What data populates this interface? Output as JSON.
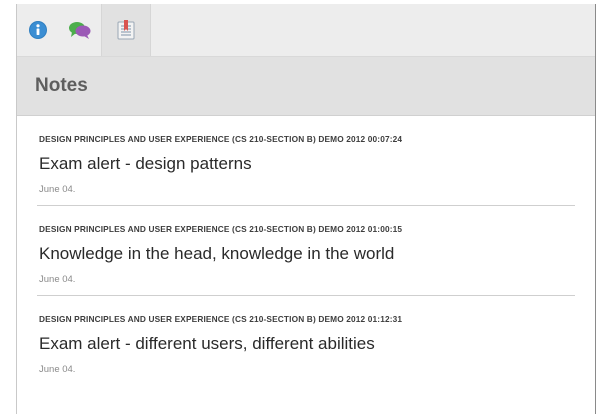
{
  "tabs": [
    {
      "icon": "info-icon",
      "active": false
    },
    {
      "icon": "chat-icon",
      "active": false
    },
    {
      "icon": "notes-bookmark-icon",
      "active": true
    }
  ],
  "panel": {
    "title": "Notes"
  },
  "notes": [
    {
      "meta": "DESIGN PRINCIPLES AND USER EXPERIENCE (CS 210-SECTION B) DEMO 2012 00:07:24",
      "title": "Exam alert - design patterns",
      "date": "June 04."
    },
    {
      "meta": "DESIGN PRINCIPLES AND USER EXPERIENCE (CS 210-SECTION B) DEMO 2012 01:00:15",
      "title": "Knowledge in the head, knowledge in the world",
      "date": "June 04."
    },
    {
      "meta": "DESIGN PRINCIPLES AND USER EXPERIENCE (CS 210-SECTION B) DEMO 2012 01:12:31",
      "title": "Exam alert - different users, different abilities",
      "date": "June 04."
    }
  ],
  "colors": {
    "info": "#2f7fc1",
    "chat_green": "#4cae4c",
    "chat_purple": "#9b59b6",
    "bookmark_red": "#d9534f"
  }
}
